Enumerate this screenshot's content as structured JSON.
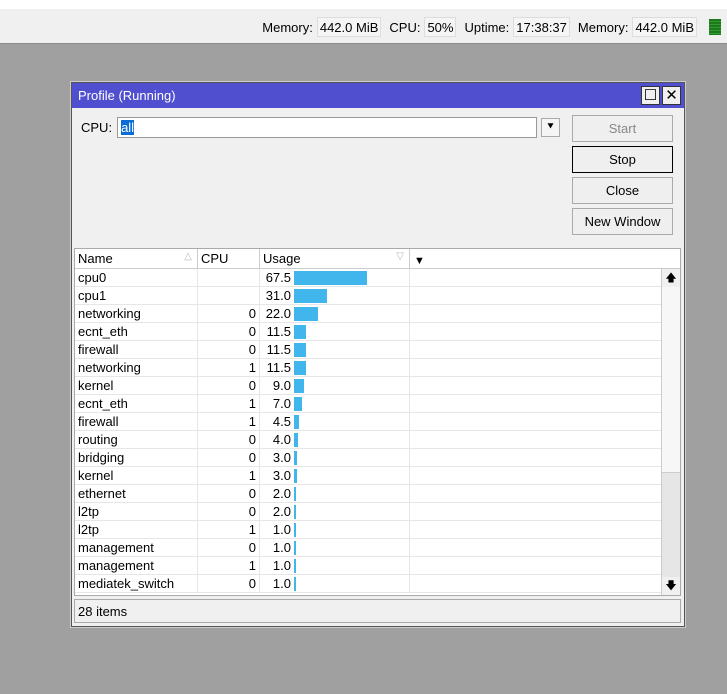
{
  "statusbar": {
    "items": [
      {
        "label": "Memory:",
        "value": "442.0 MiB"
      },
      {
        "label": "CPU:",
        "value": "50%"
      },
      {
        "label": "Uptime:",
        "value": "17:38:37"
      },
      {
        "label": "Memory:",
        "value": "442.0 MiB"
      }
    ]
  },
  "window": {
    "title": "Profile (Running)",
    "maximize": "☐",
    "close": "✕"
  },
  "form": {
    "cpu_label": "CPU:",
    "cpu_value": "all",
    "dropdown": "⯆"
  },
  "buttons": {
    "start": "Start",
    "stop": "Stop",
    "close": "Close",
    "new_window": "New Window"
  },
  "table": {
    "columns": [
      "Name",
      "CPU",
      "Usage"
    ],
    "max_usage": 100,
    "rows": [
      {
        "name": "cpu0",
        "cpu": "",
        "usage": "67.5",
        "v": 67.5
      },
      {
        "name": "cpu1",
        "cpu": "",
        "usage": "31.0",
        "v": 31.0
      },
      {
        "name": "networking",
        "cpu": "0",
        "usage": "22.0",
        "v": 22.0
      },
      {
        "name": "ecnt_eth",
        "cpu": "0",
        "usage": "11.5",
        "v": 11.5
      },
      {
        "name": "firewall",
        "cpu": "0",
        "usage": "11.5",
        "v": 11.5
      },
      {
        "name": "networking",
        "cpu": "1",
        "usage": "11.5",
        "v": 11.5
      },
      {
        "name": "kernel",
        "cpu": "0",
        "usage": "9.0",
        "v": 9.0
      },
      {
        "name": "ecnt_eth",
        "cpu": "1",
        "usage": "7.0",
        "v": 7.0
      },
      {
        "name": "firewall",
        "cpu": "1",
        "usage": "4.5",
        "v": 4.5
      },
      {
        "name": "routing",
        "cpu": "0",
        "usage": "4.0",
        "v": 4.0
      },
      {
        "name": "bridging",
        "cpu": "0",
        "usage": "3.0",
        "v": 3.0
      },
      {
        "name": "kernel",
        "cpu": "1",
        "usage": "3.0",
        "v": 3.0
      },
      {
        "name": "ethernet",
        "cpu": "0",
        "usage": "2.0",
        "v": 2.0
      },
      {
        "name": "l2tp",
        "cpu": "0",
        "usage": "2.0",
        "v": 2.0
      },
      {
        "name": "l2tp",
        "cpu": "1",
        "usage": "1.0",
        "v": 1.0
      },
      {
        "name": "management",
        "cpu": "0",
        "usage": "1.0",
        "v": 1.0
      },
      {
        "name": "management",
        "cpu": "1",
        "usage": "1.0",
        "v": 1.0
      },
      {
        "name": "mediatek_switch",
        "cpu": "0",
        "usage": "1.0",
        "v": 1.0
      }
    ]
  },
  "footer": {
    "count": "28 items"
  }
}
